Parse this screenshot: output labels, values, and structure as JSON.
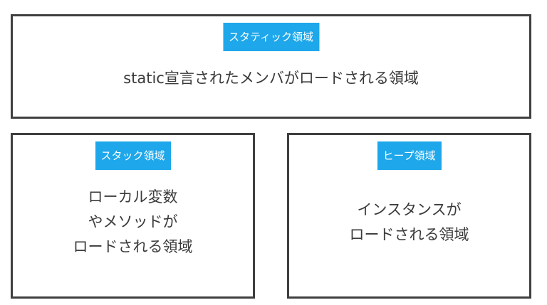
{
  "static_region": {
    "label": "スタティック領域",
    "description": "static宣言されたメンバがロードされる領域"
  },
  "stack_region": {
    "label": "スタック領域",
    "description_lines": [
      "ローカル変数",
      "やメソッドが",
      "ロードされる領域"
    ]
  },
  "heap_region": {
    "label": "ヒープ領域",
    "description_lines": [
      "インスタンスが",
      "ロードされる領域"
    ]
  }
}
